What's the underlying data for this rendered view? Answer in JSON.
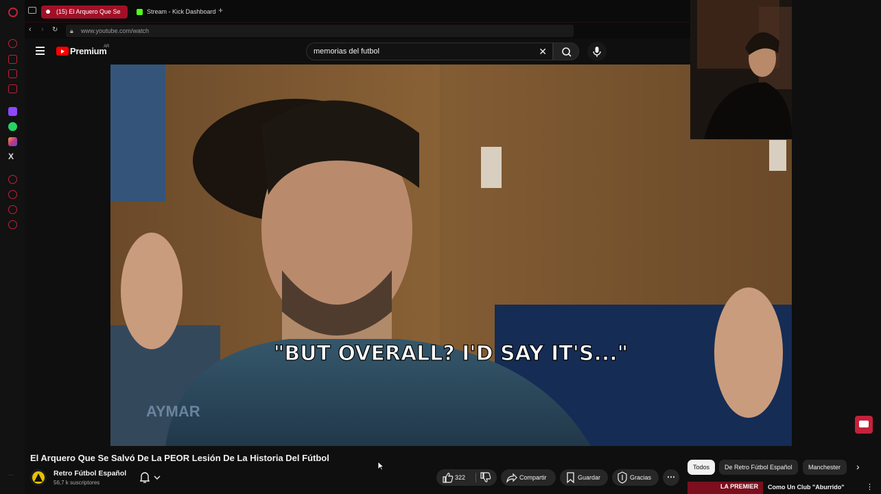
{
  "browser": {
    "tabs": [
      {
        "label": "(15) El Arquero Que Se",
        "active": true
      },
      {
        "label": "Stream - Kick Dashboard",
        "active": false
      }
    ],
    "new_tab_symbol": "+",
    "url": "www.youtube.com/watch",
    "accent_color": "#c4213a"
  },
  "youtube": {
    "logo_text": "Premium",
    "region": "AR",
    "search_value": "memorias del futbol",
    "video": {
      "subtitle": "\"BUT OVERALL? I'D SAY IT'S...\"",
      "watermark": "AYMAR"
    },
    "title": "El Arquero Que Se Salvó De La PEOR Lesión De La Historia Del Fútbol",
    "channel": {
      "name": "Retro Fútbol Español",
      "subscribers": "56,7 k suscriptores"
    },
    "actions": {
      "likes": "322",
      "share": "Compartir",
      "save": "Guardar",
      "thanks": "Gracias"
    },
    "chips": [
      "Todos",
      "De Retro Fútbol Español",
      "Manchester"
    ],
    "recommendation": {
      "thumb_text": "LA PREMIER",
      "title": "Como Un Club \"Aburrido\""
    }
  }
}
